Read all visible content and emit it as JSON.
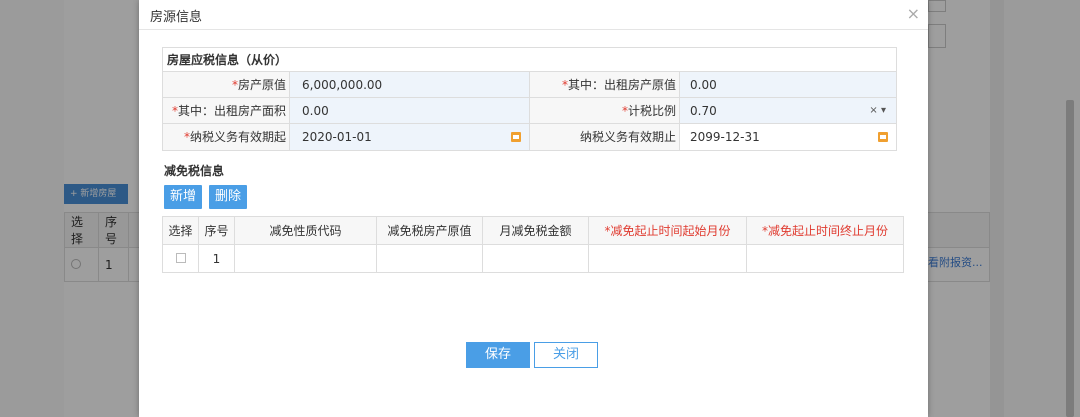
{
  "background": {
    "add_house_label": "+ 新增房屋",
    "table_headers": [
      "选择",
      "序号"
    ],
    "row_index": "1",
    "link_text": "看附报资..."
  },
  "modal": {
    "title": "房源信息",
    "close_glyph": "×",
    "tax_section": {
      "title": "房屋应税信息（从价）",
      "original_value_label": "房产原值",
      "original_value": "6,000,000.00",
      "rented_value_label": "其中：出租房产原值",
      "rented_value": "0.00",
      "rented_area_label": "其中：出租房产面积",
      "rented_area": "0.00",
      "tax_ratio_label": "计税比例",
      "tax_ratio": "0.70",
      "obligation_start_label": "纳税义务有效期起",
      "obligation_start": "2020-01-01",
      "obligation_end_label": "纳税义务有效期止",
      "obligation_end": "2099-12-31",
      "clear_glyph": "×",
      "dropdown_glyph": "▾"
    },
    "relief_section": {
      "title": "减免税信息",
      "add_label": "新增",
      "delete_label": "删除",
      "columns": [
        "选择",
        "序号",
        "减免性质代码",
        "减免税房产原值",
        "月减免税金额",
        "*减免起止时间起始月份",
        "*减免起止时间终止月份"
      ],
      "rows": [
        {
          "index": "1"
        }
      ]
    },
    "save_label": "保存",
    "close_label": "关闭"
  },
  "colors": {
    "accent": "#4a9ee6",
    "required": "#e03c31",
    "calendar_icon": "#f0a030"
  }
}
